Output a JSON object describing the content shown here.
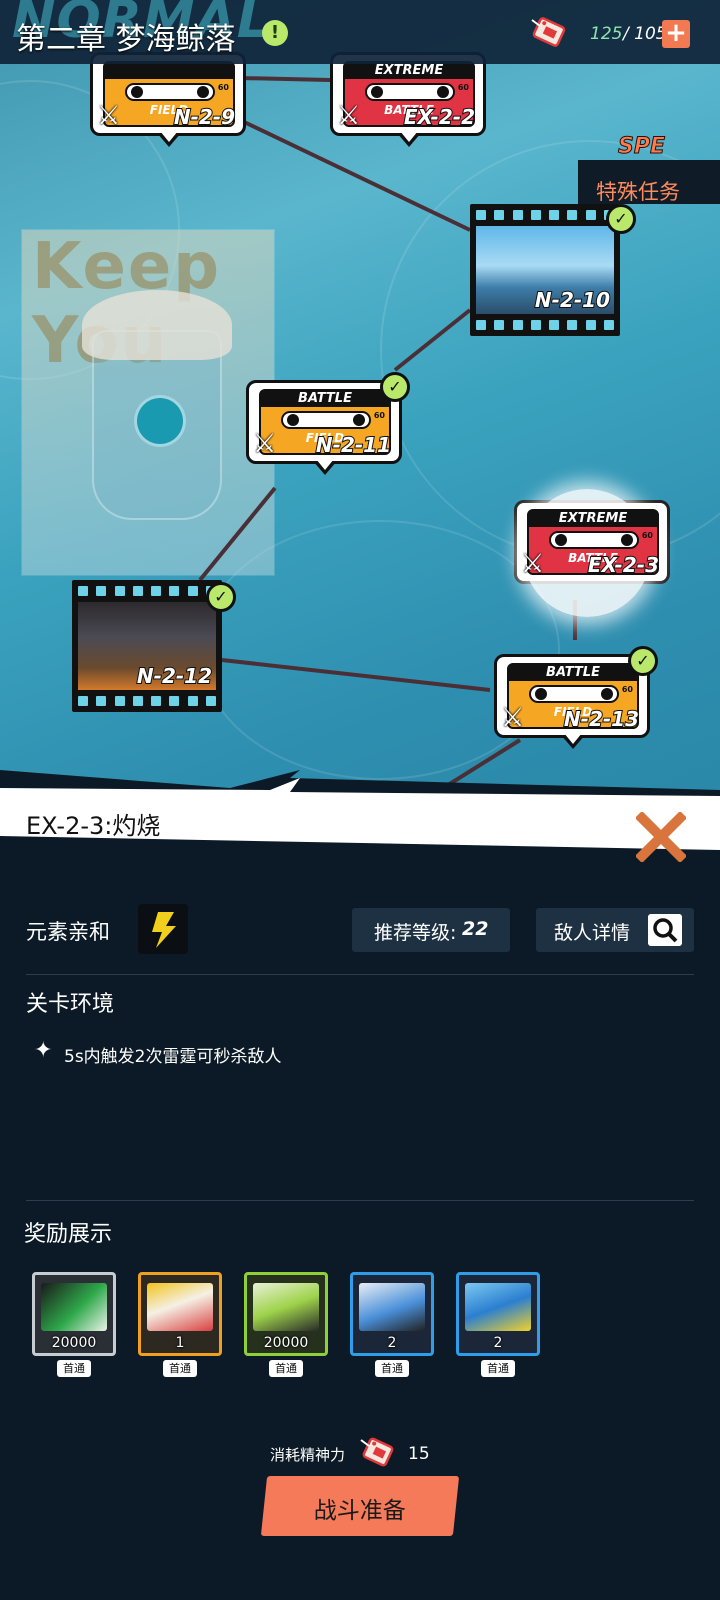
{
  "header": {
    "watermark": "NORMAL",
    "chapter_title": "第二章 梦海鲸落",
    "info_icon": "!",
    "stamina_current": "125",
    "stamina_max": "/ 105",
    "add_icon": "+"
  },
  "map": {
    "special": {
      "spe_label": "SPE",
      "label": "特殊任务"
    },
    "poster_text": "Keep You",
    "nodes": [
      {
        "code": "N-2-9",
        "type": "FIELD",
        "header": ""
      },
      {
        "code": "EX-2-2",
        "type": "BATTLE",
        "header": "EXTREME"
      },
      {
        "code": "N-2-10"
      },
      {
        "code": "N-2-11",
        "type": "FIELD",
        "header": "BATTLE"
      },
      {
        "code": "EX-2-3",
        "type": "BATTLE",
        "header": "EXTREME"
      },
      {
        "code": "N-2-12"
      },
      {
        "code": "N-2-13",
        "type": "FIELD",
        "header": "BATTLE"
      }
    ],
    "cassette_num": "60"
  },
  "detail": {
    "stage_title": "EX-2-3:灼烧",
    "element_label": "元素亲和",
    "rec_level_label": "推荐等级:",
    "rec_level_value": "22",
    "enemy_detail_label": "敌人详情",
    "env_title": "关卡环境",
    "env_text": "5s内触发2次雷霆可秒杀敌人",
    "reward_title": "奖励展示",
    "rewards": [
      {
        "qty": "20000",
        "tag": "首通"
      },
      {
        "qty": "1",
        "tag": "首通"
      },
      {
        "qty": "20000",
        "tag": "首通"
      },
      {
        "qty": "2",
        "tag": "首通"
      },
      {
        "qty": "2",
        "tag": "首通"
      }
    ],
    "cost_label": "消耗精神力",
    "cost_value": "15",
    "battle_prep_label": "战斗准备"
  },
  "colors": {
    "accent_orange": "#f47a5a",
    "panel_bg": "#0b1a26",
    "check_green": "#b9e86a"
  }
}
